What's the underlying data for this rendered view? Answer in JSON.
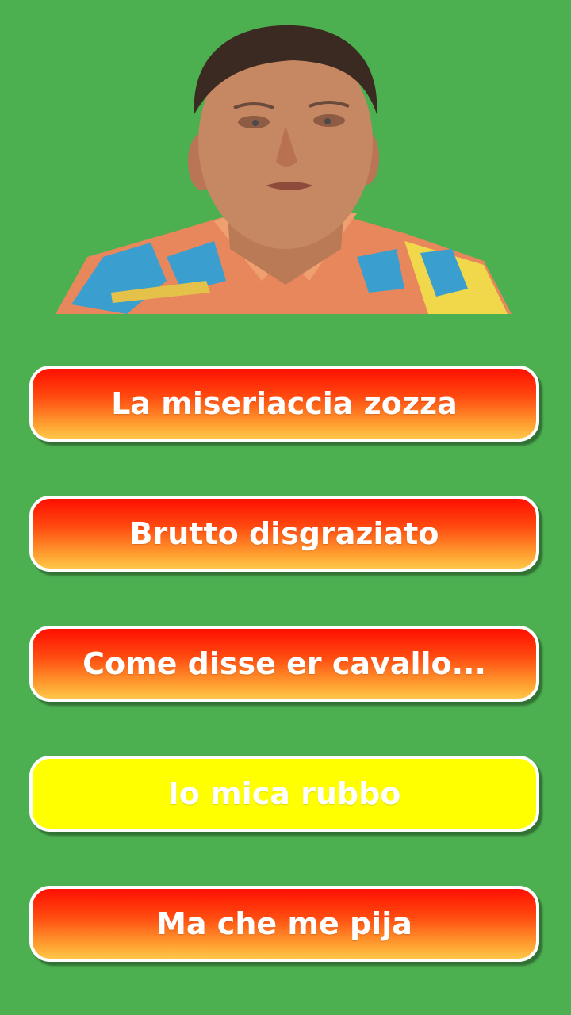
{
  "colors": {
    "background": "#4caf50",
    "button_gradient_top": "#ff0f00",
    "button_gradient_bottom": "#ffc64a",
    "button_active": "#ffff00",
    "button_border": "#ffffff",
    "label": "#ffffff"
  },
  "header": {
    "image": "actor-portrait"
  },
  "buttons": [
    {
      "label": "La miseriaccia zozza",
      "state": "normal"
    },
    {
      "label": "Brutto disgraziato",
      "state": "normal"
    },
    {
      "label": "Come disse er cavallo...",
      "state": "normal"
    },
    {
      "label": "Io mica rubbo",
      "state": "active"
    },
    {
      "label": "Ma che me pija",
      "state": "normal"
    }
  ]
}
